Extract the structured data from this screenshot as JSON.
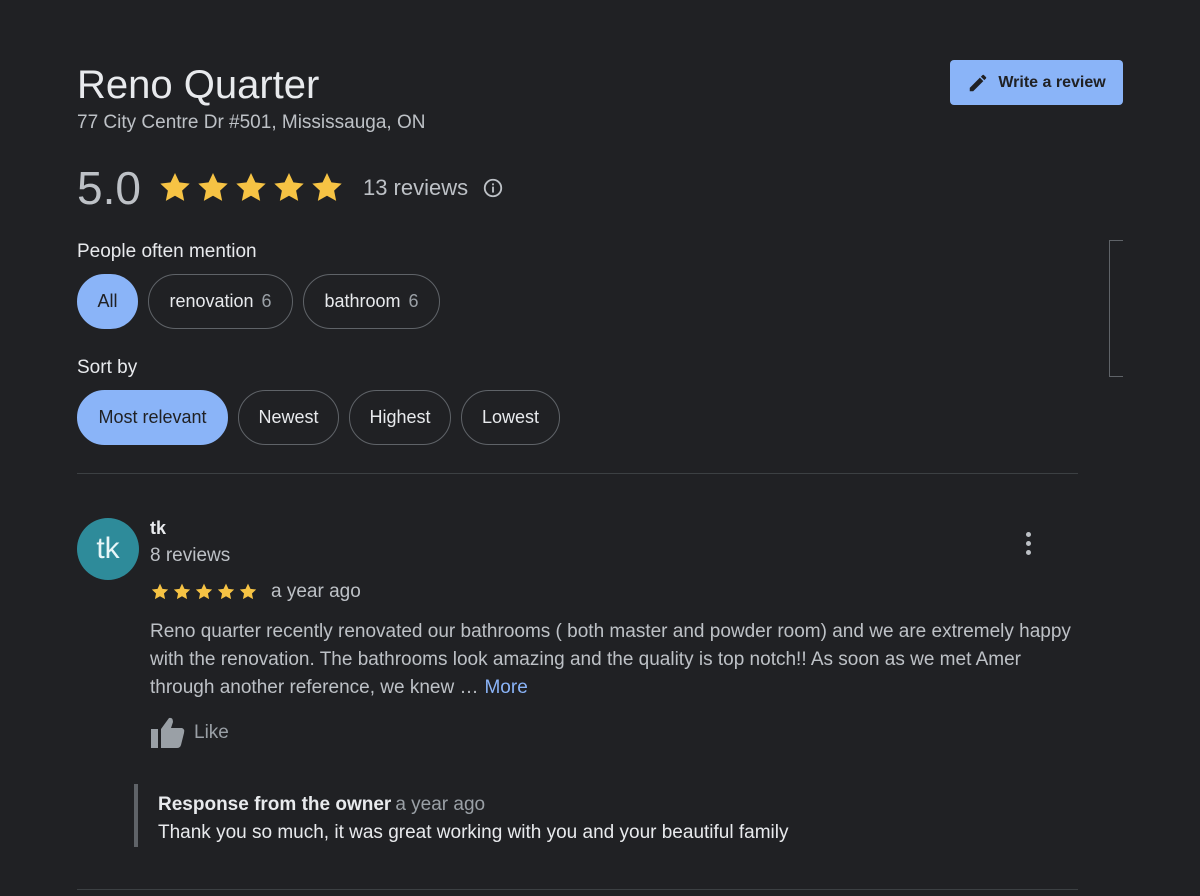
{
  "business": {
    "name": "Reno Quarter",
    "address": "77 City Centre Dr #501, Mississauga, ON",
    "write_review_label": "Write a review"
  },
  "rating": {
    "value": "5.0",
    "stars": 5,
    "review_count": "13 reviews",
    "star_color": "#f6c344"
  },
  "mentions": {
    "label": "People often mention",
    "chips": [
      {
        "label": "All",
        "count": "",
        "active": true
      },
      {
        "label": "renovation",
        "count": "6",
        "active": false
      },
      {
        "label": "bathroom",
        "count": "6",
        "active": false
      }
    ]
  },
  "sort": {
    "label": "Sort by",
    "options": [
      {
        "label": "Most relevant",
        "active": true
      },
      {
        "label": "Newest",
        "active": false
      },
      {
        "label": "Highest",
        "active": false
      },
      {
        "label": "Lowest",
        "active": false
      }
    ]
  },
  "review": {
    "avatar_initials": "tk",
    "reviewer_name": "tk",
    "reviewer_reviews": "8 reviews",
    "stars": 5,
    "date": "a year ago",
    "text": "Reno quarter recently renovated our bathrooms ( both master and powder room) and we are extremely happy with the renovation. The bathrooms look amazing and the quality is top notch!! As soon as we met Amer through another reference, we knew …",
    "more_label": "More",
    "like_label": "Like",
    "owner_response": {
      "title": "Response from the owner",
      "date": "a year ago",
      "text": "Thank you so much, it was great working with you and your beautiful family"
    }
  },
  "colors": {
    "background": "#202124",
    "accent": "#8ab4f8",
    "avatar": "#2e8b9a"
  },
  "icons": {
    "write": "pencil-icon",
    "info": "info-icon",
    "menu": "more-vert-icon",
    "like": "thumb-up-icon",
    "star": "star-icon"
  }
}
